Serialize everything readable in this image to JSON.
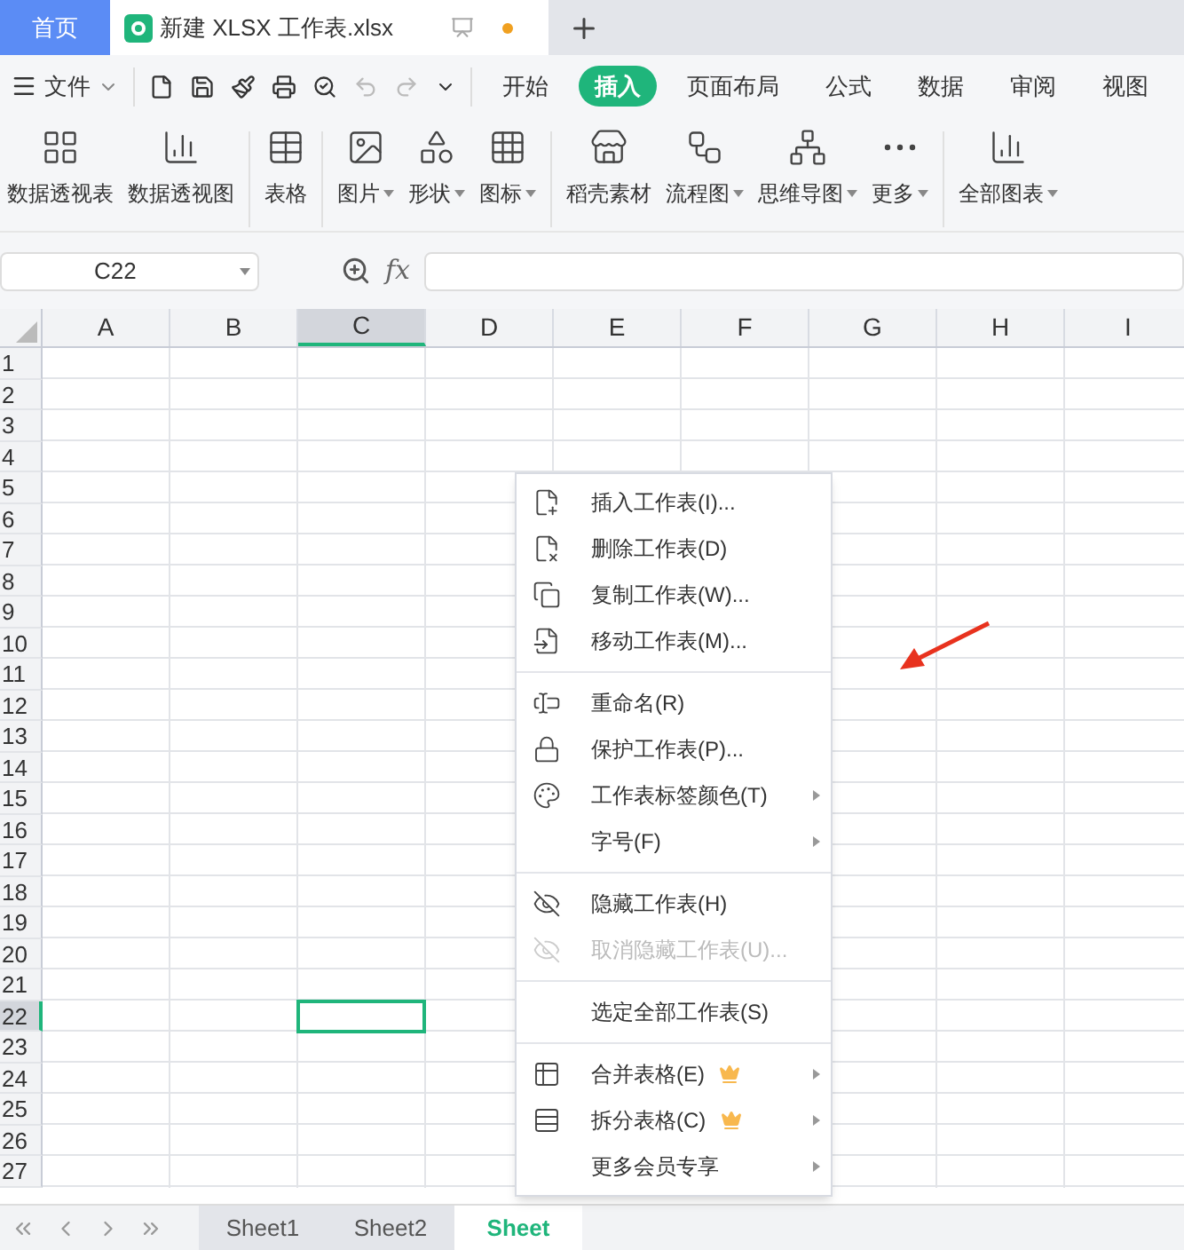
{
  "title_tabs": [
    {
      "label": "首页",
      "kind": "home",
      "selected": false
    },
    {
      "label": "新建 XLSX 工作表.xlsx",
      "kind": "document",
      "selected": true,
      "unsaved": true
    }
  ],
  "menu_bar": {
    "file_label": "文件",
    "tabs": [
      {
        "label": "开始",
        "selected": false
      },
      {
        "label": "插入",
        "selected": true
      },
      {
        "label": "页面布局",
        "selected": false
      },
      {
        "label": "公式",
        "selected": false
      },
      {
        "label": "数据",
        "selected": false
      },
      {
        "label": "审阅",
        "selected": false
      },
      {
        "label": "视图",
        "selected": false
      }
    ]
  },
  "ribbon": [
    {
      "items": [
        {
          "label": "数据透视表",
          "dropdown": false
        },
        {
          "label": "数据透视图",
          "dropdown": false
        }
      ]
    },
    {
      "items": [
        {
          "label": "表格",
          "dropdown": false
        }
      ]
    },
    {
      "items": [
        {
          "label": "图片",
          "dropdown": true
        },
        {
          "label": "形状",
          "dropdown": true
        },
        {
          "label": "图标",
          "dropdown": true
        }
      ]
    },
    {
      "items": [
        {
          "label": "稻壳素材",
          "dropdown": false
        },
        {
          "label": "流程图",
          "dropdown": true
        },
        {
          "label": "思维导图",
          "dropdown": true
        },
        {
          "label": "更多",
          "dropdown": true
        }
      ]
    },
    {
      "items": [
        {
          "label": "全部图表",
          "dropdown": true
        }
      ]
    }
  ],
  "formula_bar": {
    "name_box": "C22",
    "fx": "fx"
  },
  "grid": {
    "columns": [
      {
        "label": "A",
        "selected": false
      },
      {
        "label": "B",
        "selected": false
      },
      {
        "label": "C",
        "selected": true
      },
      {
        "label": "D",
        "selected": false
      },
      {
        "label": "E",
        "selected": false
      },
      {
        "label": "F",
        "selected": false
      },
      {
        "label": "G",
        "selected": false
      },
      {
        "label": "H",
        "selected": false
      },
      {
        "label": "I",
        "selected": false
      }
    ],
    "rows": [
      {
        "label": "1",
        "selected": false
      },
      {
        "label": "2",
        "selected": false
      },
      {
        "label": "3",
        "selected": false
      },
      {
        "label": "4",
        "selected": false
      },
      {
        "label": "5",
        "selected": false
      },
      {
        "label": "6",
        "selected": false
      },
      {
        "label": "7",
        "selected": false
      },
      {
        "label": "8",
        "selected": false
      },
      {
        "label": "9",
        "selected": false
      },
      {
        "label": "10",
        "selected": false
      },
      {
        "label": "11",
        "selected": false
      },
      {
        "label": "12",
        "selected": false
      },
      {
        "label": "13",
        "selected": false
      },
      {
        "label": "14",
        "selected": false
      },
      {
        "label": "15",
        "selected": false
      },
      {
        "label": "16",
        "selected": false
      },
      {
        "label": "17",
        "selected": false
      },
      {
        "label": "18",
        "selected": false
      },
      {
        "label": "19",
        "selected": false
      },
      {
        "label": "20",
        "selected": false
      },
      {
        "label": "21",
        "selected": false
      },
      {
        "label": "22",
        "selected": true
      },
      {
        "label": "23",
        "selected": false
      },
      {
        "label": "24",
        "selected": false
      },
      {
        "label": "25",
        "selected": false
      },
      {
        "label": "26",
        "selected": false
      },
      {
        "label": "27",
        "selected": false
      }
    ]
  },
  "context_menu": [
    {
      "kind": "item",
      "label": "插入工作表(I)...",
      "disabled": false,
      "submenu": false,
      "premium": false
    },
    {
      "kind": "item",
      "label": "删除工作表(D)",
      "disabled": false,
      "submenu": false,
      "premium": false
    },
    {
      "kind": "item",
      "label": "复制工作表(W)...",
      "disabled": false,
      "submenu": false,
      "premium": false
    },
    {
      "kind": "item",
      "label": "移动工作表(M)...",
      "disabled": false,
      "submenu": false,
      "premium": false
    },
    {
      "kind": "separator"
    },
    {
      "kind": "item",
      "label": "重命名(R)",
      "disabled": false,
      "submenu": false,
      "premium": false
    },
    {
      "kind": "item",
      "label": "保护工作表(P)...",
      "disabled": false,
      "submenu": false,
      "premium": false
    },
    {
      "kind": "item",
      "label": "工作表标签颜色(T)",
      "disabled": false,
      "submenu": true,
      "premium": false
    },
    {
      "kind": "item",
      "label": "字号(F)",
      "disabled": false,
      "submenu": true,
      "premium": false
    },
    {
      "kind": "separator"
    },
    {
      "kind": "item",
      "label": "隐藏工作表(H)",
      "disabled": false,
      "submenu": false,
      "premium": false
    },
    {
      "kind": "item",
      "label": "取消隐藏工作表(U)...",
      "disabled": true,
      "submenu": false,
      "premium": false
    },
    {
      "kind": "separator"
    },
    {
      "kind": "item",
      "label": "选定全部工作表(S)",
      "disabled": false,
      "submenu": false,
      "premium": false
    },
    {
      "kind": "separator"
    },
    {
      "kind": "item",
      "label": "合并表格(E)",
      "disabled": false,
      "submenu": true,
      "premium": true
    },
    {
      "kind": "item",
      "label": "拆分表格(C)",
      "disabled": false,
      "submenu": true,
      "premium": true
    },
    {
      "kind": "item",
      "label": "更多会员专享",
      "disabled": false,
      "submenu": true,
      "premium": false
    }
  ],
  "sheet_tabs": [
    {
      "label": "Sheet1",
      "selected": false
    },
    {
      "label": "Sheet2",
      "selected": false
    },
    {
      "label": "Sheet",
      "selected": true
    }
  ]
}
